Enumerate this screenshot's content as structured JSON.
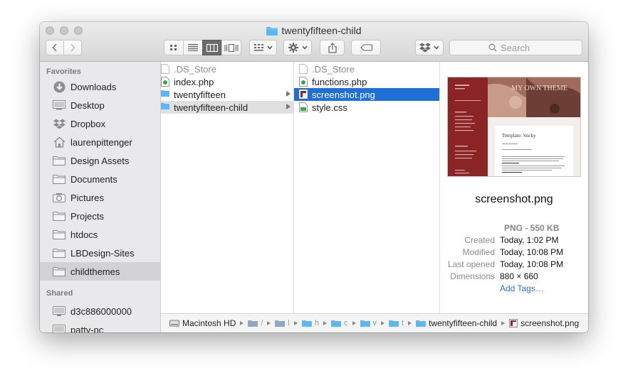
{
  "window": {
    "title": "twentyfifteen-child"
  },
  "toolbar": {
    "search_placeholder": "Search"
  },
  "sidebar": {
    "favorites_label": "Favorites",
    "favorites": [
      {
        "label": "Downloads",
        "icon": "downloads-icon"
      },
      {
        "label": "Desktop",
        "icon": "desktop-icon"
      },
      {
        "label": "Dropbox",
        "icon": "dropbox-icon"
      },
      {
        "label": "laurenpittenger",
        "icon": "home-icon"
      },
      {
        "label": "Design Assets",
        "icon": "folder-icon"
      },
      {
        "label": "Documents",
        "icon": "folder-icon"
      },
      {
        "label": "Pictures",
        "icon": "camera-icon"
      },
      {
        "label": "Projects",
        "icon": "folder-icon"
      },
      {
        "label": "htdocs",
        "icon": "folder-icon"
      },
      {
        "label": "LBDesign-Sites",
        "icon": "folder-icon"
      },
      {
        "label": "childthemes",
        "icon": "folder-icon",
        "selected": true
      }
    ],
    "shared_label": "Shared",
    "shared": [
      {
        "label": "d3c886000000",
        "icon": "computer-icon"
      },
      {
        "label": "patty-pc",
        "icon": "computer-icon"
      }
    ]
  },
  "columns": {
    "col1": [
      {
        "label": ".DS_Store",
        "dim": true
      },
      {
        "label": "index.php"
      },
      {
        "label": "twentyfifteen",
        "folder": true
      },
      {
        "label": "twentyfifteen-child",
        "folder": true,
        "highlight": true
      }
    ],
    "col2": [
      {
        "label": ".DS_Store",
        "dim": true
      },
      {
        "label": "functions.php"
      },
      {
        "label": "screenshot.png",
        "selected": true
      },
      {
        "label": "style.css"
      }
    ]
  },
  "preview": {
    "file_name": "screenshot.png",
    "kind": "PNG - 550 KB",
    "meta": [
      {
        "key": "Created",
        "value": "Today, 1:02 PM"
      },
      {
        "key": "Modified",
        "value": "Today, 10:08 PM"
      },
      {
        "key": "Last opened",
        "value": "Today, 10:08 PM"
      },
      {
        "key": "Dimensions",
        "value": "880 × 660"
      }
    ],
    "add_tags": "Add Tags…",
    "thumb_heading": "MY OWN THEME",
    "thumb_card_title": "Template: Sticky"
  },
  "pathbar": {
    "root": "Macintosh HD",
    "abbrevs": [
      "/",
      "l",
      "h",
      "c",
      "v",
      "t"
    ],
    "current_folder": "twentyfifteen-child",
    "current_file": "screenshot.png"
  },
  "colors": {
    "selection": "#1f6fd6",
    "folder": "#5db7f0",
    "sidebar_bg": "#e9e9eb"
  }
}
